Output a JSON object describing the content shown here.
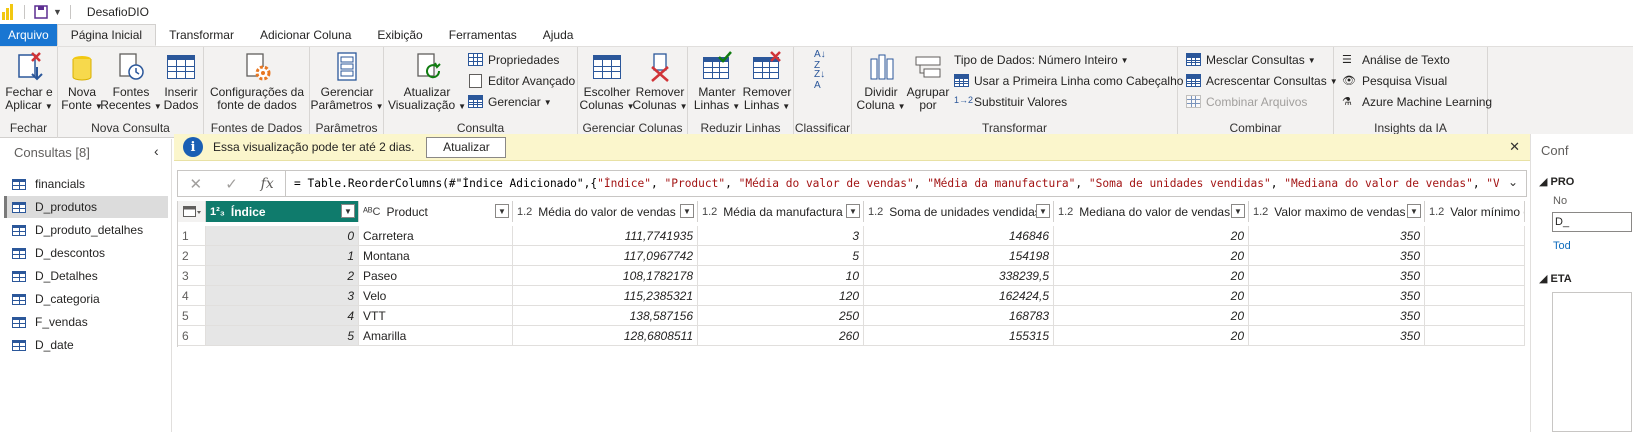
{
  "window": {
    "title": "DesafioDIO"
  },
  "tabs": [
    "Arquivo",
    "Página Inicial",
    "Transformar",
    "Adicionar Coluna",
    "Exibição",
    "Ferramentas",
    "Ajuda"
  ],
  "ribbon": {
    "groups": {
      "fechar": "Fechar",
      "nova_consulta": "Nova Consulta",
      "fontes_dados": "Fontes de Dados",
      "parametros": "Parâmetros",
      "consulta": "Consulta",
      "gerenciar_colunas": "Gerenciar Colunas",
      "reduzir_linhas": "Reduzir Linhas",
      "classificar": "Classificar",
      "transformar": "Transformar",
      "combinar": "Combinar",
      "insights": "Insights da IA"
    },
    "buttons": {
      "fechar_aplicar": [
        "Fechar e",
        "Aplicar"
      ],
      "nova_fonte": [
        "Nova",
        "Fonte"
      ],
      "fontes_recentes": [
        "Fontes",
        "Recentes"
      ],
      "inserir_dados": [
        "Inserir",
        "Dados"
      ],
      "config_fonte": [
        "Configurações da",
        "fonte de dados"
      ],
      "gerenciar_parametros": [
        "Gerenciar",
        "Parâmetros"
      ],
      "atualizar_visualizacao": [
        "Atualizar",
        "Visualização"
      ],
      "propriedades": "Propriedades",
      "editor_avancado": "Editor Avançado",
      "gerenciar": "Gerenciar",
      "escolher_colunas": [
        "Escolher",
        "Colunas"
      ],
      "remover_colunas": [
        "Remover",
        "Colunas"
      ],
      "manter_linhas": [
        "Manter",
        "Linhas"
      ],
      "remover_linhas": [
        "Remover",
        "Linhas"
      ],
      "dividir_coluna": [
        "Dividir",
        "Coluna"
      ],
      "agrupar_por": [
        "Agrupar",
        "por"
      ],
      "tipo_dados": "Tipo de Dados: Número Inteiro",
      "primeira_linha": "Usar a Primeira Linha como Cabeçalho",
      "substituir_valores": "Substituir Valores",
      "mesclar": "Mesclar Consultas",
      "acrescentar": "Acrescentar Consultas",
      "combinar_arquivos": "Combinar Arquivos",
      "analise_texto": "Análise de Texto",
      "pesquisa_visual": "Pesquisa Visual",
      "azure_ml": "Azure Machine Learning"
    }
  },
  "queries": {
    "title": "Consultas [8]",
    "items": [
      "financials",
      "D_produtos",
      "D_produto_detalhes",
      "D_descontos",
      "D_Detalhes",
      "D_categoria",
      "F_vendas",
      "D_date"
    ],
    "selected": "D_produtos"
  },
  "infobar": {
    "text": "Essa visualização pode ter até 2 dias.",
    "button": "Atualizar"
  },
  "formula": {
    "prefix": "= Table.ReorderColumns(#\"Índice Adicionado\",{",
    "strings": [
      "\"Índice\"",
      "\"Product\"",
      "\"Média do valor de vendas\"",
      "\"Média da manufactura\"",
      "\"Soma de unidades vendidas\"",
      "\"Mediana do valor de vendas\"",
      "\"Valor"
    ]
  },
  "table": {
    "columns": [
      {
        "type": "1²₃",
        "name": "Índice"
      },
      {
        "type": "ᴬᴮC",
        "name": "Product"
      },
      {
        "type": "1.2",
        "name": "Média do valor de vendas"
      },
      {
        "type": "1.2",
        "name": "Média da manufactura"
      },
      {
        "type": "1.2",
        "name": "Soma de unidades vendidas"
      },
      {
        "type": "1.2",
        "name": "Mediana do valor de vendas"
      },
      {
        "type": "1.2",
        "name": "Valor maximo de vendas"
      },
      {
        "type": "1.2",
        "name": "Valor mínimo de"
      }
    ],
    "rows": [
      [
        "1",
        "0",
        "Carretera",
        "111,7741935",
        "3",
        "146846",
        "20",
        "350",
        ""
      ],
      [
        "2",
        "1",
        "Montana",
        "117,0967742",
        "5",
        "154198",
        "20",
        "350",
        ""
      ],
      [
        "3",
        "2",
        "Paseo",
        "108,1782178",
        "10",
        "338239,5",
        "20",
        "350",
        ""
      ],
      [
        "4",
        "3",
        "Velo",
        "115,2385321",
        "120",
        "162424,5",
        "20",
        "350",
        ""
      ],
      [
        "5",
        "4",
        "VTT",
        "138,587156",
        "250",
        "168783",
        "20",
        "350",
        ""
      ],
      [
        "6",
        "5",
        "Amarilla",
        "128,6808511",
        "260",
        "155315",
        "20",
        "350",
        ""
      ]
    ]
  },
  "right_panel": {
    "title": "Conf",
    "section1": "PRO",
    "label_name": "No",
    "name_value": "D_",
    "all_props": "Tod",
    "section2": "ETA"
  },
  "colors": {
    "accent": "#1aa89f",
    "selected_header": "#0f7b6c",
    "file_tab": "#1976d2",
    "info_bg": "#fbf6cc"
  }
}
